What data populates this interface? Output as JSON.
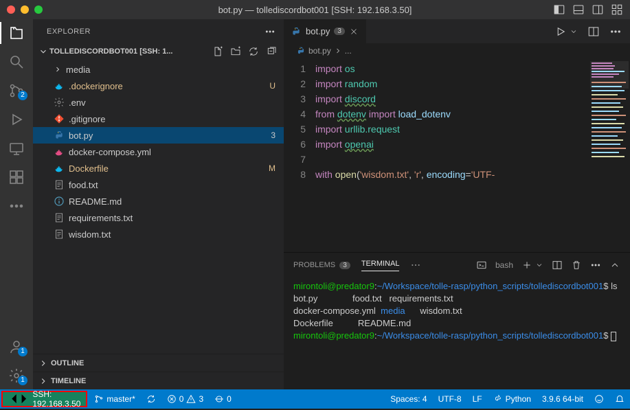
{
  "app": {
    "title": "bot.py — tollediscordbot001 [SSH: 192.168.3.50]"
  },
  "activity": {
    "scm_badge": "2",
    "accounts_badge": "1",
    "settings_badge": "1"
  },
  "explorer": {
    "title": "EXPLORER",
    "folder": "TOLLEDISCORDBOT001 [SSH: 1...",
    "items": [
      {
        "label": "media",
        "icon": "folder",
        "expandable": true
      },
      {
        "label": ".dockerignore",
        "icon": "docker",
        "status": "U"
      },
      {
        "label": ".env",
        "icon": "gear"
      },
      {
        "label": ".gitignore",
        "icon": "git"
      },
      {
        "label": "bot.py",
        "icon": "python",
        "status": "3",
        "selected": true
      },
      {
        "label": "docker-compose.yml",
        "icon": "docker"
      },
      {
        "label": "Dockerfile",
        "icon": "docker",
        "status": "M"
      },
      {
        "label": "food.txt",
        "icon": "text"
      },
      {
        "label": "README.md",
        "icon": "info"
      },
      {
        "label": "requirements.txt",
        "icon": "text"
      },
      {
        "label": "wisdom.txt",
        "icon": "text"
      }
    ],
    "outline": "OUTLINE",
    "timeline": "TIMELINE"
  },
  "tab": {
    "name": "bot.py",
    "badge": "3"
  },
  "breadcrumb": {
    "file": "bot.py",
    "rest": "..."
  },
  "code": {
    "lines": [
      "1",
      "2",
      "3",
      "4",
      "5",
      "6",
      "7",
      "8"
    ],
    "l1_kw": "import",
    "l1_m": "os",
    "l2_kw": "import",
    "l2_m": "random",
    "l3_kw": "import",
    "l3_m": "discord",
    "l4_kw": "from",
    "l4_m": "dotenv",
    "l4_kw2": "import",
    "l4_m2": "load_dotenv",
    "l5_kw": "import",
    "l5_m": "urllib.request",
    "l6_kw": "import",
    "l6_m": "openai",
    "l8_kw": "with",
    "l8_fn": "open",
    "l8_s1": "'wisdom.txt'",
    "l8_s2": "'r'",
    "l8_s3": "'UTF-",
    "l8_arg": "encoding"
  },
  "panel": {
    "problems": "PROBLEMS",
    "problems_count": "3",
    "terminal": "TERMINAL",
    "shell": "bash",
    "user": "mirontoli@predator9",
    "path": "~/Workspace/tolle-rasp/python_scripts/tollediscordbot001",
    "cmd": "ls",
    "out1": "bot.py              food.txt   requirements.txt",
    "out2_a": "docker-compose.yml  ",
    "out2_b": "media",
    "out2_c": "      wisdom.txt",
    "out3": "Dockerfile          README.md"
  },
  "status": {
    "ssh": "SSH: 192.168.3.50",
    "branch": "master*",
    "errors": "0",
    "warnings": "3",
    "port": "0",
    "spaces": "Spaces: 4",
    "encoding": "UTF-8",
    "eol": "LF",
    "lang": "Python",
    "ver": "3.9.6 64-bit"
  }
}
